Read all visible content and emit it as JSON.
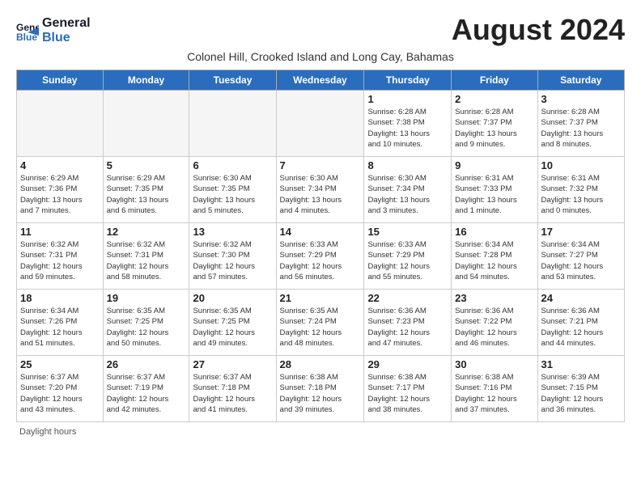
{
  "header": {
    "logo_line1": "General",
    "logo_line2": "Blue",
    "month_title": "August 2024",
    "subtitle": "Colonel Hill, Crooked Island and Long Cay, Bahamas"
  },
  "days_of_week": [
    "Sunday",
    "Monday",
    "Tuesday",
    "Wednesday",
    "Thursday",
    "Friday",
    "Saturday"
  ],
  "weeks": [
    [
      {
        "day": "",
        "info": ""
      },
      {
        "day": "",
        "info": ""
      },
      {
        "day": "",
        "info": ""
      },
      {
        "day": "",
        "info": ""
      },
      {
        "day": "1",
        "info": "Sunrise: 6:28 AM\nSunset: 7:38 PM\nDaylight: 13 hours\nand 10 minutes."
      },
      {
        "day": "2",
        "info": "Sunrise: 6:28 AM\nSunset: 7:37 PM\nDaylight: 13 hours\nand 9 minutes."
      },
      {
        "day": "3",
        "info": "Sunrise: 6:28 AM\nSunset: 7:37 PM\nDaylight: 13 hours\nand 8 minutes."
      }
    ],
    [
      {
        "day": "4",
        "info": "Sunrise: 6:29 AM\nSunset: 7:36 PM\nDaylight: 13 hours\nand 7 minutes."
      },
      {
        "day": "5",
        "info": "Sunrise: 6:29 AM\nSunset: 7:35 PM\nDaylight: 13 hours\nand 6 minutes."
      },
      {
        "day": "6",
        "info": "Sunrise: 6:30 AM\nSunset: 7:35 PM\nDaylight: 13 hours\nand 5 minutes."
      },
      {
        "day": "7",
        "info": "Sunrise: 6:30 AM\nSunset: 7:34 PM\nDaylight: 13 hours\nand 4 minutes."
      },
      {
        "day": "8",
        "info": "Sunrise: 6:30 AM\nSunset: 7:34 PM\nDaylight: 13 hours\nand 3 minutes."
      },
      {
        "day": "9",
        "info": "Sunrise: 6:31 AM\nSunset: 7:33 PM\nDaylight: 13 hours\nand 1 minute."
      },
      {
        "day": "10",
        "info": "Sunrise: 6:31 AM\nSunset: 7:32 PM\nDaylight: 13 hours\nand 0 minutes."
      }
    ],
    [
      {
        "day": "11",
        "info": "Sunrise: 6:32 AM\nSunset: 7:31 PM\nDaylight: 12 hours\nand 59 minutes."
      },
      {
        "day": "12",
        "info": "Sunrise: 6:32 AM\nSunset: 7:31 PM\nDaylight: 12 hours\nand 58 minutes."
      },
      {
        "day": "13",
        "info": "Sunrise: 6:32 AM\nSunset: 7:30 PM\nDaylight: 12 hours\nand 57 minutes."
      },
      {
        "day": "14",
        "info": "Sunrise: 6:33 AM\nSunset: 7:29 PM\nDaylight: 12 hours\nand 56 minutes."
      },
      {
        "day": "15",
        "info": "Sunrise: 6:33 AM\nSunset: 7:29 PM\nDaylight: 12 hours\nand 55 minutes."
      },
      {
        "day": "16",
        "info": "Sunrise: 6:34 AM\nSunset: 7:28 PM\nDaylight: 12 hours\nand 54 minutes."
      },
      {
        "day": "17",
        "info": "Sunrise: 6:34 AM\nSunset: 7:27 PM\nDaylight: 12 hours\nand 53 minutes."
      }
    ],
    [
      {
        "day": "18",
        "info": "Sunrise: 6:34 AM\nSunset: 7:26 PM\nDaylight: 12 hours\nand 51 minutes."
      },
      {
        "day": "19",
        "info": "Sunrise: 6:35 AM\nSunset: 7:25 PM\nDaylight: 12 hours\nand 50 minutes."
      },
      {
        "day": "20",
        "info": "Sunrise: 6:35 AM\nSunset: 7:25 PM\nDaylight: 12 hours\nand 49 minutes."
      },
      {
        "day": "21",
        "info": "Sunrise: 6:35 AM\nSunset: 7:24 PM\nDaylight: 12 hours\nand 48 minutes."
      },
      {
        "day": "22",
        "info": "Sunrise: 6:36 AM\nSunset: 7:23 PM\nDaylight: 12 hours\nand 47 minutes."
      },
      {
        "day": "23",
        "info": "Sunrise: 6:36 AM\nSunset: 7:22 PM\nDaylight: 12 hours\nand 46 minutes."
      },
      {
        "day": "24",
        "info": "Sunrise: 6:36 AM\nSunset: 7:21 PM\nDaylight: 12 hours\nand 44 minutes."
      }
    ],
    [
      {
        "day": "25",
        "info": "Sunrise: 6:37 AM\nSunset: 7:20 PM\nDaylight: 12 hours\nand 43 minutes."
      },
      {
        "day": "26",
        "info": "Sunrise: 6:37 AM\nSunset: 7:19 PM\nDaylight: 12 hours\nand 42 minutes."
      },
      {
        "day": "27",
        "info": "Sunrise: 6:37 AM\nSunset: 7:18 PM\nDaylight: 12 hours\nand 41 minutes."
      },
      {
        "day": "28",
        "info": "Sunrise: 6:38 AM\nSunset: 7:18 PM\nDaylight: 12 hours\nand 39 minutes."
      },
      {
        "day": "29",
        "info": "Sunrise: 6:38 AM\nSunset: 7:17 PM\nDaylight: 12 hours\nand 38 minutes."
      },
      {
        "day": "30",
        "info": "Sunrise: 6:38 AM\nSunset: 7:16 PM\nDaylight: 12 hours\nand 37 minutes."
      },
      {
        "day": "31",
        "info": "Sunrise: 6:39 AM\nSunset: 7:15 PM\nDaylight: 12 hours\nand 36 minutes."
      }
    ]
  ],
  "footer": {
    "daylight_label": "Daylight hours"
  }
}
